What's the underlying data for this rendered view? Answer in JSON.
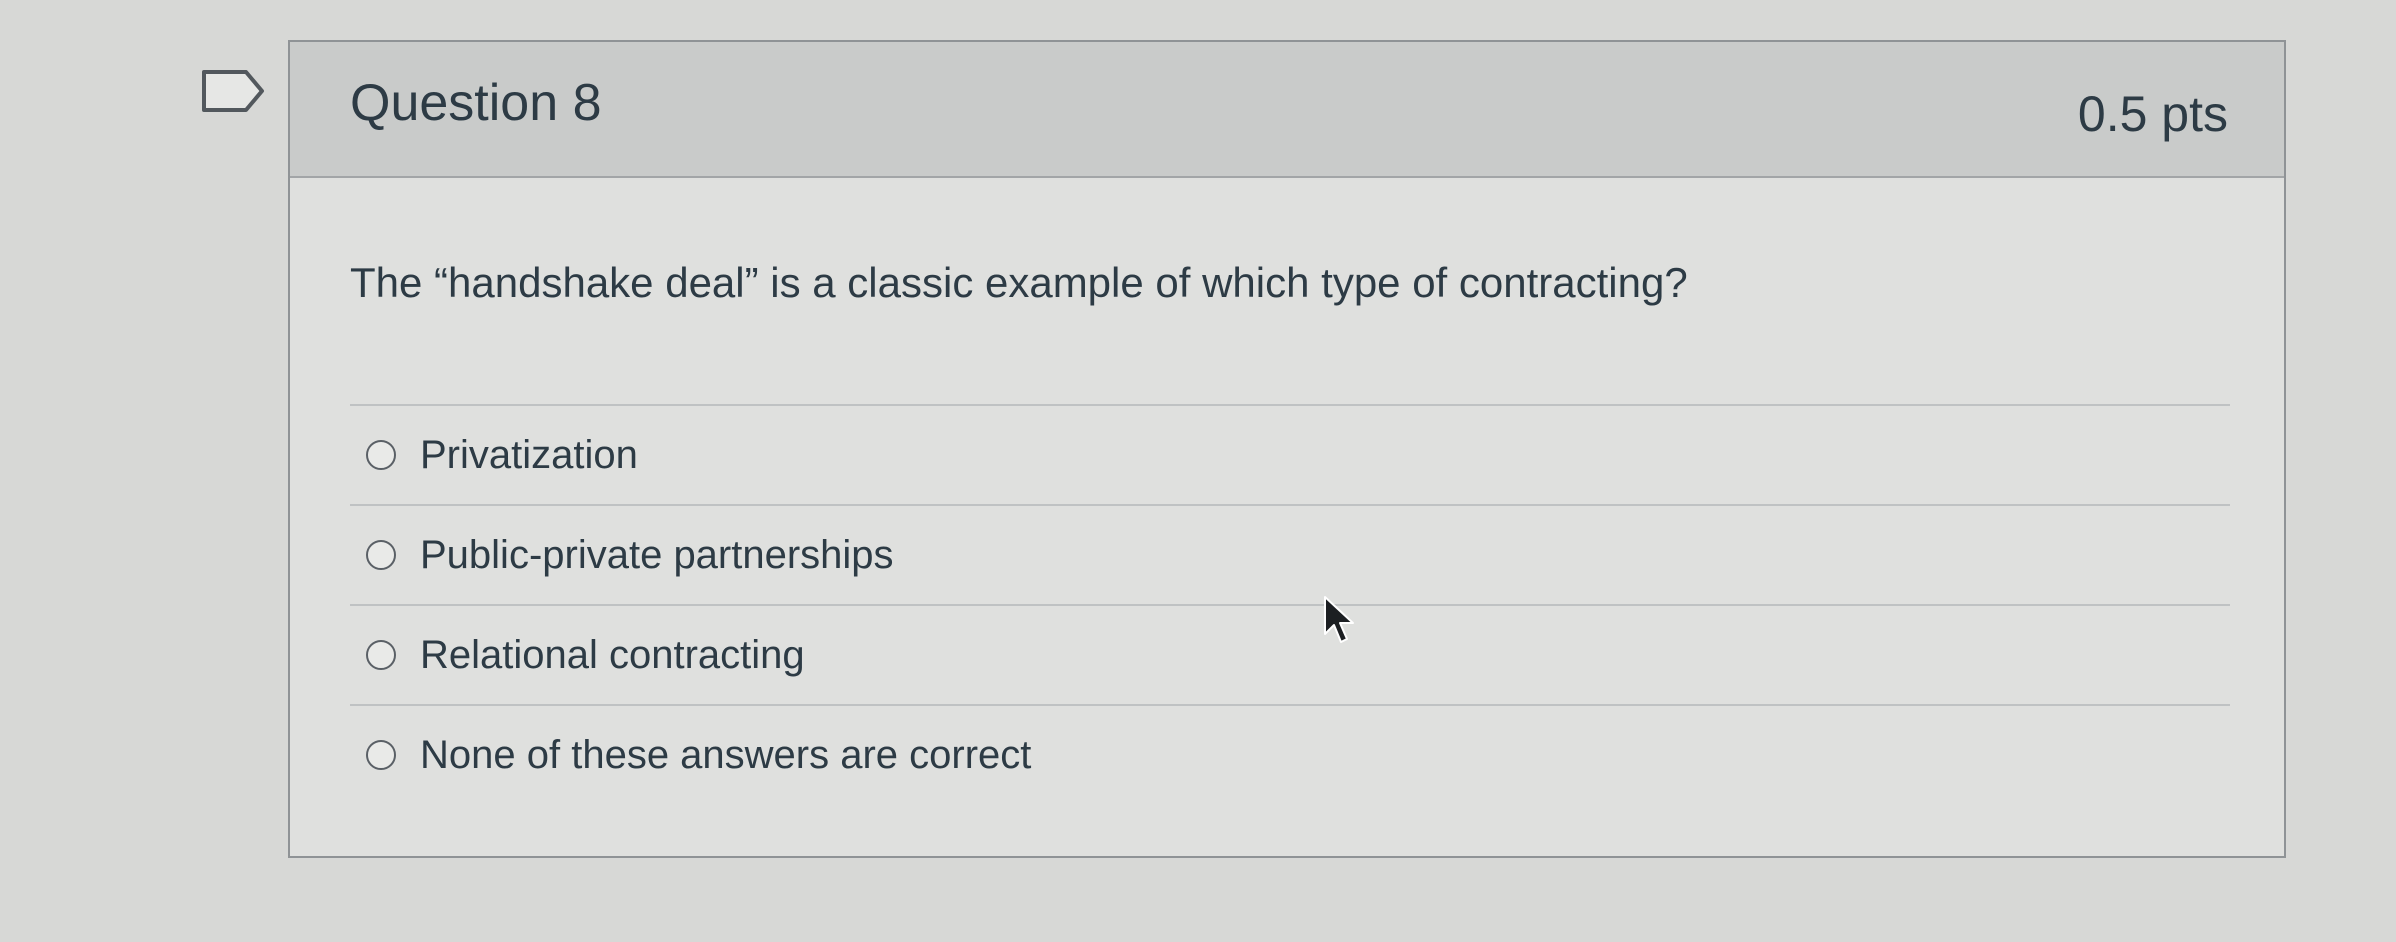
{
  "question": {
    "title": "Question 8",
    "points": "0.5 pts",
    "text": "The “handshake deal” is a classic example of which type of contracting?"
  },
  "answers": [
    {
      "label": "Privatization",
      "selected": false
    },
    {
      "label": "Public-private partnerships",
      "selected": false
    },
    {
      "label": "Relational contracting",
      "selected": false
    },
    {
      "label": "None of these answers are correct",
      "selected": false
    }
  ],
  "icons": {
    "flag": "flag-bookmark-icon",
    "cursor": "mouse-pointer-icon",
    "radio": "radio-empty-icon"
  },
  "colors": {
    "header_bg": "#c9cbca",
    "body_bg": "#dfe0de",
    "text": "#2d3b45"
  }
}
